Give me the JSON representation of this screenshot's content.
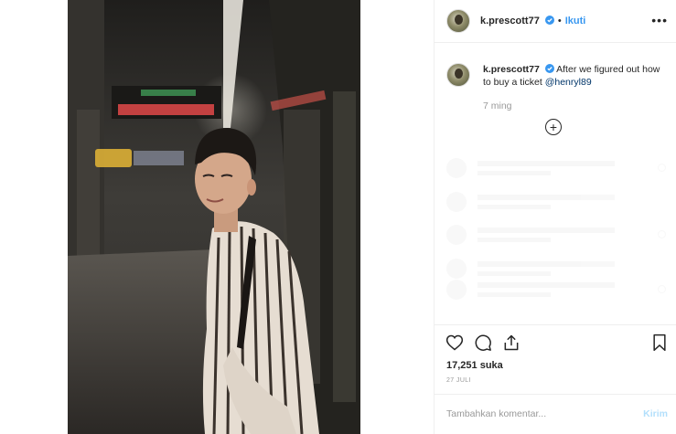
{
  "post": {
    "username": "k.prescott77",
    "follow_label": "Ikuti",
    "separator": "•",
    "more_label": "•••",
    "caption": {
      "username": "k.prescott77",
      "text": "After we figured out how to buy a ticket",
      "mention": "@henryl89"
    },
    "time_ago": "7 ming",
    "load_more_label": "+",
    "likes": "17,251 suka",
    "date": "27 JULI",
    "comment_placeholder": "Tambahkan komentar...",
    "post_label": "Kirim"
  },
  "colors": {
    "accent": "#3897f0",
    "mention": "#003569",
    "post_disabled": "#b2dffc",
    "muted": "#999999",
    "border": "#efefef"
  },
  "icons": {
    "like": "heart-icon",
    "comment": "comment-bubble-icon",
    "share": "share-icon",
    "save": "bookmark-icon",
    "verified": "verified-badge-icon",
    "more": "ellipsis-icon",
    "load_more": "plus-circle-icon"
  }
}
